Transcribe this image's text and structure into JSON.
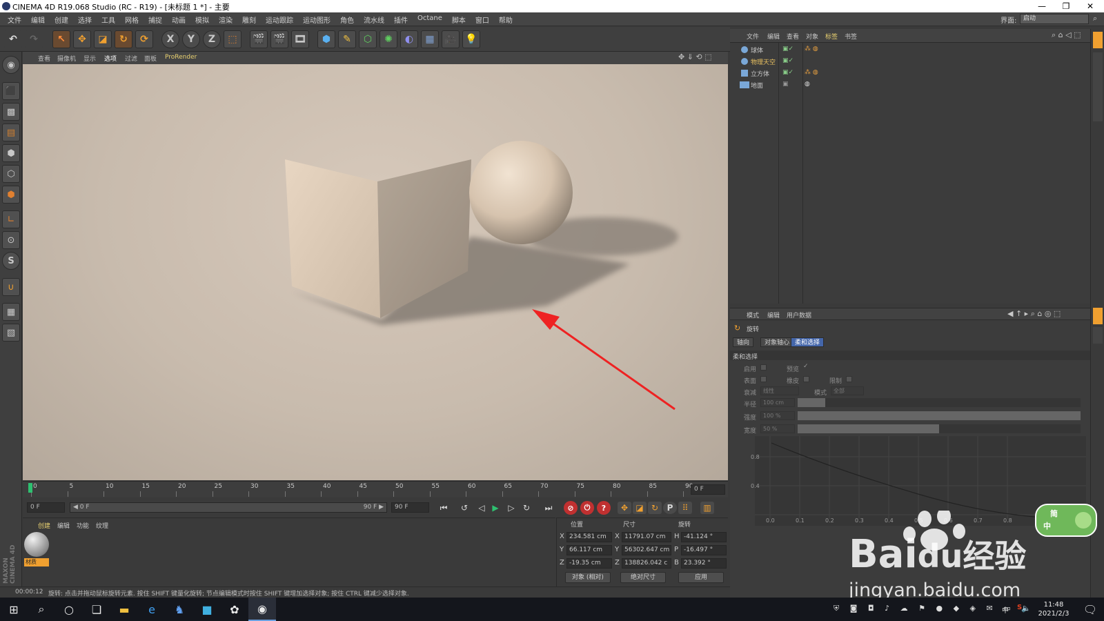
{
  "window": {
    "title": "CINEMA 4D R19.068 Studio (RC - R19) - [未标题 1 *] - 主要",
    "minimize": "—",
    "restore": "❐",
    "close": "✕"
  },
  "menu": {
    "items": [
      "文件",
      "编辑",
      "创建",
      "选择",
      "工具",
      "网格",
      "捕捉",
      "动画",
      "模拟",
      "渲染",
      "雕刻",
      "运动跟踪",
      "运动图形",
      "角色",
      "流水线",
      "插件",
      "Octane",
      "脚本",
      "窗口",
      "帮助"
    ],
    "interface_label": "界面:",
    "interface_value": "启动"
  },
  "toolbar": {
    "undo": "↶",
    "redo": "↷",
    "axis_x": "X",
    "axis_y": "Y",
    "axis_z": "Z"
  },
  "viewport": {
    "menus": [
      "查看",
      "摄像机",
      "显示",
      "选项",
      "过滤",
      "面板"
    ],
    "renderer": "ProRender",
    "shadow_color": "#7d7570",
    "object_color": "#d8c7b4",
    "arrow_color": "#ee2222"
  },
  "timeline": {
    "ticks": [
      "0",
      "5",
      "10",
      "15",
      "20",
      "25",
      "30",
      "35",
      "40",
      "45",
      "50",
      "55",
      "60",
      "65",
      "70",
      "75",
      "80",
      "85",
      "90"
    ],
    "current_frame": "0 F",
    "start": "0 F",
    "range_start": "◀ 0 F",
    "range_end": "90 F ▶",
    "end": "90 F"
  },
  "material_panel": {
    "menus": [
      "创建",
      "编辑",
      "功能",
      "纹理"
    ],
    "material_name": "材质",
    "brand": "MAXON CINEMA 4D"
  },
  "coordinates": {
    "headers": [
      "位置",
      "尺寸",
      "旋转"
    ],
    "rows": [
      {
        "axis": "X",
        "pos": "234.581 cm",
        "size_axis": "X",
        "size": "11791.07 cm",
        "rot_axis": "H",
        "rot": "-41.124 °"
      },
      {
        "axis": "Y",
        "pos": "66.117 cm",
        "size_axis": "Y",
        "size": "56302.647 cm",
        "rot_axis": "P",
        "rot": "-16.497 °"
      },
      {
        "axis": "Z",
        "pos": "-19.35 cm",
        "size_axis": "Z",
        "size": "138826.042 c",
        "rot_axis": "B",
        "rot": "23.392 °"
      }
    ],
    "mode": "对象 (相对)",
    "size_mode": "绝对尺寸",
    "apply": "应用"
  },
  "status": {
    "time": "00:00:12",
    "message": "旋转: 点击并拖动鼠标旋转元素. 按住 SHIFT 键量化旋转; 节点编辑模式时按住 SHIFT 键增加选择对象; 按住 CTRL 键减少选择对象."
  },
  "object_manager": {
    "menus": [
      "文件",
      "编辑",
      "查看",
      "对象",
      "标签",
      "书签"
    ],
    "objects": [
      {
        "name": "球体",
        "color": "#c8c8c8"
      },
      {
        "name": "物理天空",
        "color": "#e8c060"
      },
      {
        "name": "立方体",
        "color": "#c8c8c8"
      },
      {
        "name": "地面",
        "color": "#c8c8c8"
      }
    ]
  },
  "attribute_manager": {
    "menus": [
      "模式",
      "编辑",
      "用户数据"
    ],
    "tool_name": "旋转",
    "tabs": [
      "轴向",
      "对象轴心",
      "柔和选择"
    ],
    "section": "柔和选择",
    "fields": {
      "enable": "启用",
      "preview": "预览",
      "surface": "表面",
      "rubber": "橡皮",
      "limit": "限制",
      "falloff": "衰减",
      "falloff_value": "线性",
      "mode": "模式",
      "mode_value": "全部",
      "radius": "半径",
      "radius_value": "100 cm",
      "strength": "强度",
      "strength_value": "100 %",
      "width": "宽度",
      "width_value": "50 %"
    },
    "graph_y": [
      "0.8",
      "0.4"
    ],
    "graph_x": [
      "0.0",
      "0.1",
      "0.2",
      "0.3",
      "0.4",
      "0.5",
      "0.6",
      "0.7",
      "0.8"
    ]
  },
  "taskbar": {
    "clock_time": "11:48",
    "clock_date": "2021/2/3",
    "ime": "中"
  },
  "watermark": {
    "brand": "Bai",
    "brand2": "du",
    "suffix": "经验",
    "url": "jingyan.baidu.com",
    "badge": "简",
    "badge2": "中"
  }
}
